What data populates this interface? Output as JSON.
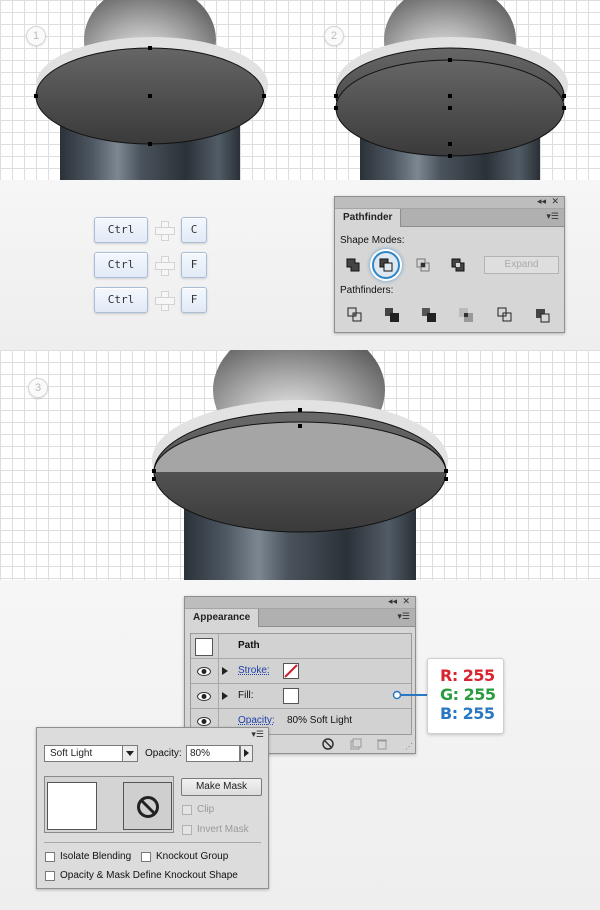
{
  "steps": [
    {
      "number": "1"
    },
    {
      "number": "2"
    },
    {
      "number": "3"
    }
  ],
  "shortcuts": [
    {
      "modifier": "Ctrl",
      "key": "C"
    },
    {
      "modifier": "Ctrl",
      "key": "F"
    },
    {
      "modifier": "Ctrl",
      "key": "F"
    }
  ],
  "pathfinder": {
    "title": "Pathfinder",
    "shape_modes_label": "Shape Modes:",
    "pathfinders_label": "Pathfinders:",
    "expand_label": "Expand",
    "selected_shape_mode": "minus-front",
    "shape_mode_icons": [
      "unite-icon",
      "minus-front-icon",
      "intersect-icon",
      "exclude-icon"
    ],
    "pathfinder_icons": [
      "divide-icon",
      "trim-icon",
      "merge-icon",
      "crop-icon",
      "outline-icon",
      "minus-back-icon"
    ]
  },
  "appearance": {
    "title": "Appearance",
    "object_label": "Path",
    "stroke_label": "Stroke:",
    "fill_label": "Fill:",
    "opacity_label": "Opacity:",
    "opacity_value": "80% Soft Light"
  },
  "fill_color": {
    "r_label": "R: 255",
    "g_label": "G: 255",
    "b_label": "B: 255",
    "r_color": "#d9232e",
    "g_color": "#2a9b3e",
    "b_color": "#2a78c2"
  },
  "transparency": {
    "blend_mode": "Soft Light",
    "opacity_label": "Opacity:",
    "opacity_value": "80%",
    "make_mask_label": "Make Mask",
    "clip_label": "Clip",
    "invert_mask_label": "Invert Mask",
    "isolate_label": "Isolate Blending",
    "knockout_label": "Knockout Group",
    "define_knockout_label": "Opacity & Mask Define Knockout Shape"
  },
  "colors": {
    "selection_ring": "#2f86c6",
    "key_border": "#a9bdd6"
  }
}
